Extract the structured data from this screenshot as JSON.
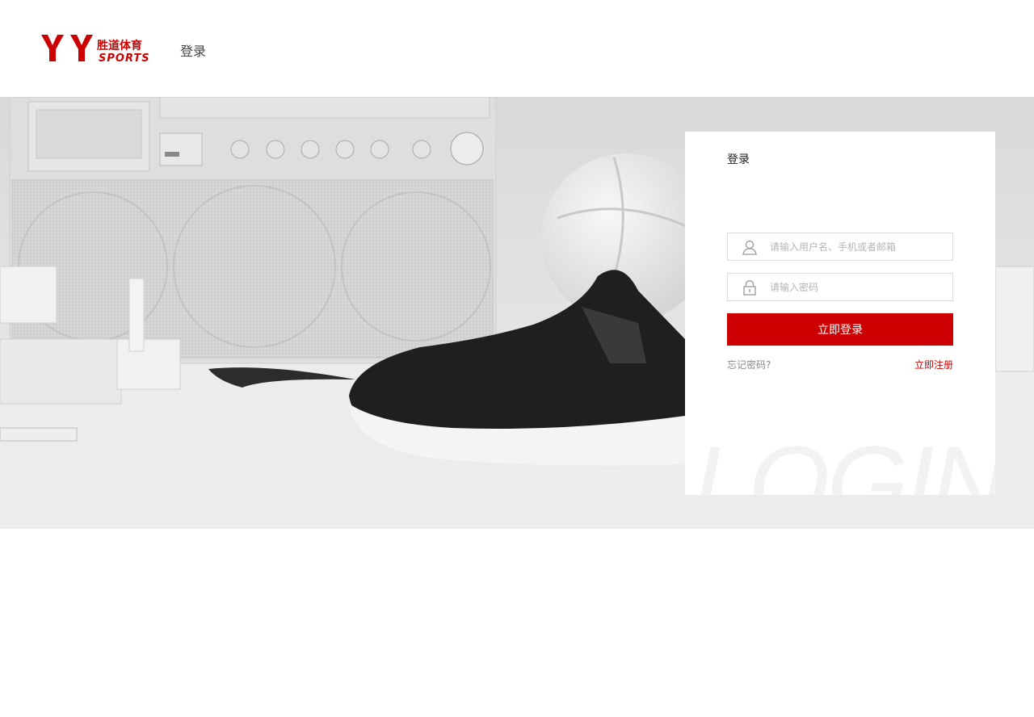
{
  "brand": {
    "logo_letters": "YY",
    "logo_cn": "胜道体育",
    "logo_en": "SPORTS",
    "color": "#cc0000"
  },
  "header": {
    "title": "登录"
  },
  "login": {
    "title": "登录",
    "username": {
      "placeholder": "请输入用户名、手机或者邮箱",
      "icon": "user-icon"
    },
    "password": {
      "placeholder": "请输入密码",
      "icon": "lock-icon"
    },
    "submit_label": "立即登录",
    "forgot_label": "忘记密码?",
    "register_label": "立即注册",
    "watermark": "LOGIN"
  }
}
